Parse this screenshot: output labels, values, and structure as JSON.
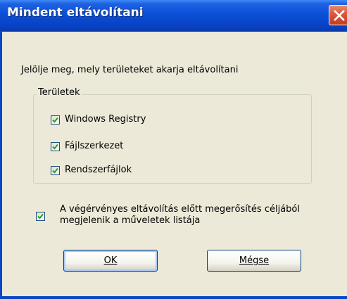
{
  "dialog": {
    "title": "Mindent eltávolítani",
    "instruction": "Jelölje meg, mely területeket akarja eltávolítani"
  },
  "areas": {
    "legend": "Területek",
    "items": [
      {
        "label": "Windows Registry",
        "checked": true
      },
      {
        "label": "Fájlszerkezet",
        "checked": true
      },
      {
        "label": "Rendszerfájlok",
        "checked": true
      }
    ]
  },
  "confirm": {
    "line1": "A végérvényes eltávolítás előtt megerősítés céljából",
    "line2": "megjelenik a műveletek listája",
    "checked": true
  },
  "buttons": {
    "ok_label": "OK",
    "cancel_label": "Mégse"
  },
  "colors": {
    "titlebar": "#0a4fd6",
    "dialog_bg": "#ece9d8",
    "check": "#21a121",
    "close_button": "#d9573a"
  }
}
